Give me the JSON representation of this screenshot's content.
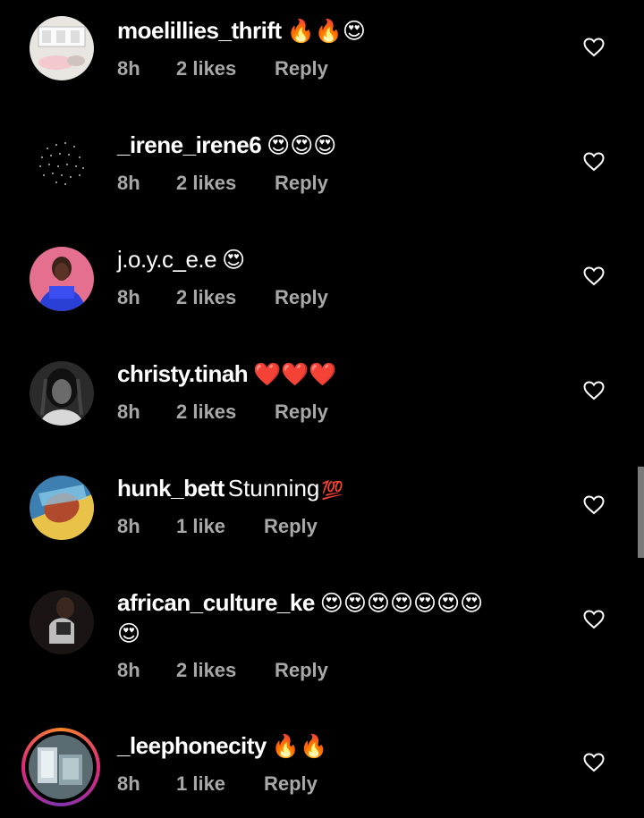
{
  "comments": [
    {
      "username": "moelillies_thrift",
      "text": "",
      "emoji": "🔥🔥😍",
      "time": "8h",
      "likes": "2 likes",
      "reply": "Reply"
    },
    {
      "username": "_irene_irene6",
      "text": "",
      "emoji": "😍😍😍",
      "time": "8h",
      "likes": "2 likes",
      "reply": "Reply"
    },
    {
      "username": "j.o.y.c_e.e",
      "text": "",
      "emoji": "😍",
      "time": "8h",
      "likes": "2 likes",
      "reply": "Reply"
    },
    {
      "username": "christy.tinah",
      "text": "",
      "emoji": "❤️❤️❤️",
      "time": "8h",
      "likes": "2 likes",
      "reply": "Reply"
    },
    {
      "username": "hunk_bett",
      "text": "Stunning",
      "emoji": "💯",
      "time": "8h",
      "likes": "1 like",
      "reply": "Reply"
    },
    {
      "username": "african_culture_ke",
      "text": "",
      "emoji": "😍😍😍😍😍😍😍",
      "emoji_line2": "😍",
      "time": "8h",
      "likes": "2 likes",
      "reply": "Reply"
    },
    {
      "username": "_leephonecity",
      "text": "",
      "emoji": "🔥🔥",
      "time": "8h",
      "likes": "1 like",
      "reply": "Reply"
    }
  ],
  "colors": {
    "background": "#000000",
    "meta_text": "#a8a8a8",
    "heart_stroke": "#ffffff"
  },
  "icons": {
    "like": "heart-outline-icon"
  }
}
